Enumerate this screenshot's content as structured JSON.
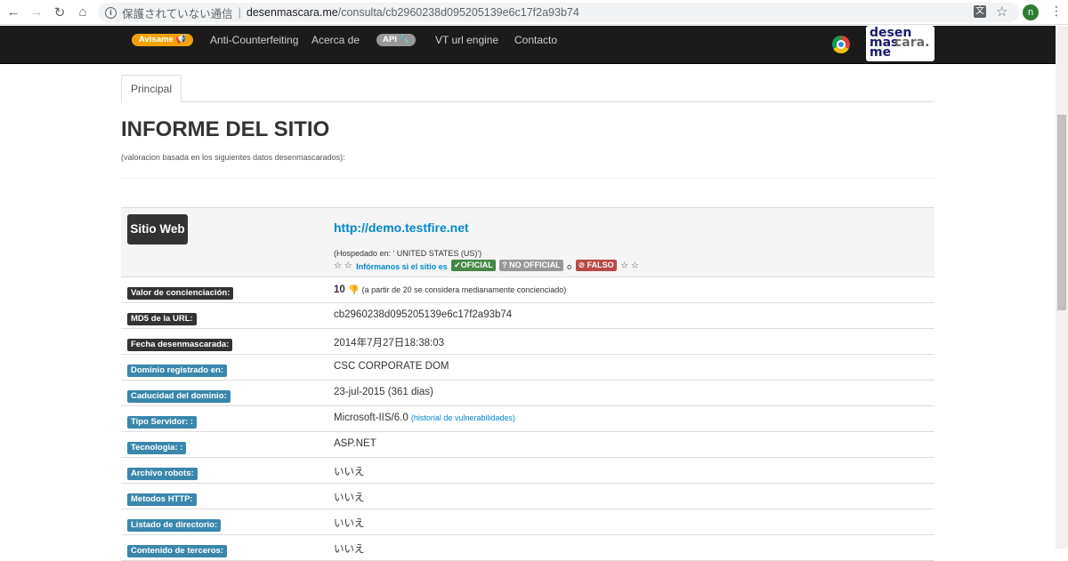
{
  "browser": {
    "security_text": "保護されていない通信",
    "url_domain": "desenmascara.me",
    "url_path": "/consulta/cb2960238d095205139e6c17f2a93b74",
    "profile_initial": "n",
    "translate_glyph": "文"
  },
  "navbar": {
    "avisame_label": "Avisame",
    "items": [
      "Anti-Counterfeiting",
      "Acerca de",
      "VT url engine",
      "Contacto"
    ],
    "api_label": "API",
    "logo_lines": [
      "desen",
      "mas",
      "cara.",
      "me"
    ]
  },
  "tabs": [
    {
      "label": "Principal",
      "active": true
    }
  ],
  "report": {
    "title": "INFORME DEL SITIO",
    "subtitle": "(valoracion basada en los siguientes datos desenmascarados):",
    "site": {
      "label": "Sitio Web",
      "url": "http://demo.testfire.net",
      "hosted": "(Hospedado en: ' UNITED STATES (US)')",
      "stars": "☆ ☆",
      "tell_us": "Infórmanos si el sitio es",
      "official": "OFICIAL",
      "no_official": "NO OFFICIAL",
      "or": "o",
      "fake": "FALSO",
      "stars_end": "☆ ☆"
    },
    "rows": [
      {
        "label": "Valor de concienciación:",
        "value": "10",
        "note": "(a partir de 20 se considera medianamente concienciado)",
        "color": "dark"
      },
      {
        "label": "MD5 de la URL:",
        "value": "cb2960238d095205139e6c17f2a93b74",
        "color": "dark"
      },
      {
        "label": "Fecha desenmascarada:",
        "value": "2014年7月27日18:38:03",
        "color": "dark"
      },
      {
        "label": "Dominio registrado en:",
        "value": "CSC CORPORATE DOM",
        "color": "blue"
      },
      {
        "label": "Caducidad del dominio:",
        "value": "23-jul-2015 (361 dias)",
        "color": "blue"
      },
      {
        "label": "Tipo Servidor: :",
        "value": "Microsoft-IIS/6.0",
        "link": "(historial de vulnerabilidades)",
        "color": "blue"
      },
      {
        "label": "Tecnologia: :",
        "value": "ASP.NET",
        "color": "blue"
      },
      {
        "label": "Archivo robots:",
        "value": "いいえ",
        "color": "blue"
      },
      {
        "label": "Metodos HTTP:",
        "value": "いいえ",
        "color": "blue"
      },
      {
        "label": "Listado de directorio:",
        "value": "いいえ",
        "color": "blue"
      },
      {
        "label": "Contenido de terceros:",
        "value": "いいえ",
        "color": "blue"
      }
    ]
  }
}
